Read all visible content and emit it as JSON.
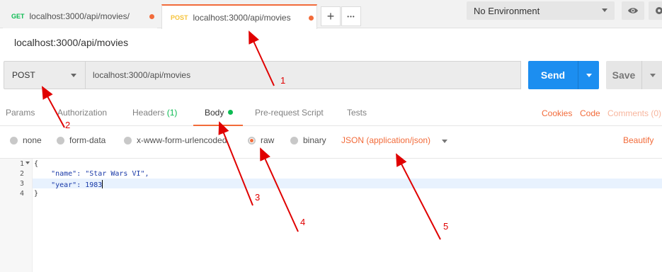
{
  "tabs": [
    {
      "method": "GET",
      "url": "localhost:3000/api/movies/"
    },
    {
      "method": "POST",
      "url": "localhost:3000/api/movies"
    }
  ],
  "tab_actions": {
    "new_tab_glyph": "+",
    "more_glyph": "•••"
  },
  "environment": {
    "selected": "No Environment"
  },
  "request": {
    "title": "localhost:3000/api/movies",
    "method": "POST",
    "url": "localhost:3000/api/movies",
    "send_label": "Send",
    "save_label": "Save"
  },
  "request_tabs": {
    "params": "Params",
    "authorization": "Authorization",
    "headers": "Headers",
    "headers_count": "(1)",
    "body": "Body",
    "prerequest": "Pre-request Script",
    "tests": "Tests",
    "cookies": "Cookies",
    "code": "Code",
    "comments": "Comments (0)"
  },
  "body_options": {
    "none": "none",
    "form_data": "form-data",
    "urlencoded": "x-www-form-urlencoded",
    "raw": "raw",
    "binary": "binary",
    "content_type": "JSON (application/json)",
    "beautify": "Beautify",
    "selected": "raw"
  },
  "editor": {
    "line_numbers": [
      "1",
      "2",
      "3",
      "4"
    ],
    "lines": [
      "{",
      "    \"name\": \"Star Wars VI\",",
      "    \"year\": 1983",
      "}"
    ]
  },
  "annotations": [
    "1",
    "2",
    "3",
    "4",
    "5"
  ],
  "colors": {
    "accent": "#f26b3a",
    "send": "#1c8ef0",
    "annotation": "#e00000",
    "success": "#0cbb52"
  }
}
